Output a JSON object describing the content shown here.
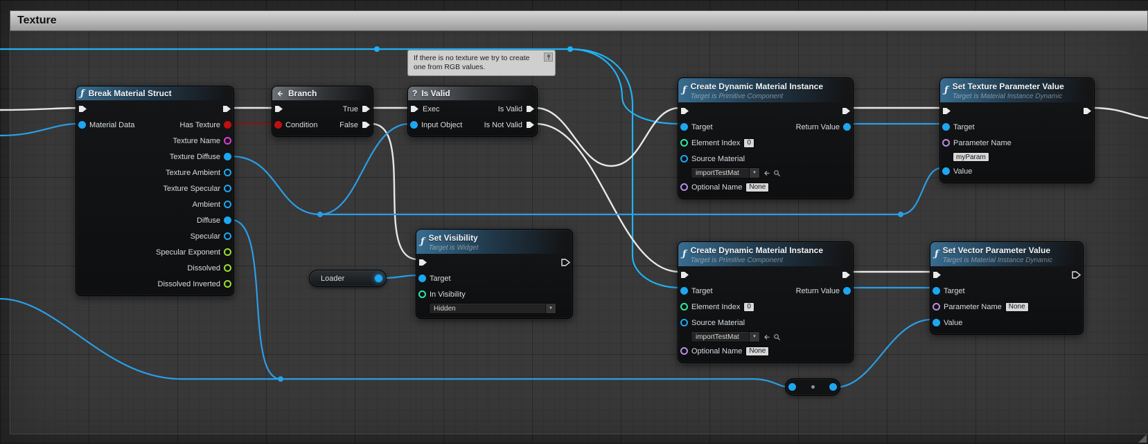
{
  "comment": {
    "title": "Texture"
  },
  "note": {
    "line1": "If there is no texture we try to create",
    "line2": "one from RGB values."
  },
  "nodes": {
    "break_material": {
      "title": "Break Material Struct",
      "input_label": "Material Data",
      "outputs": [
        {
          "label": "Has Texture",
          "type": "bool"
        },
        {
          "label": "Texture Name",
          "type": "string"
        },
        {
          "label": "Texture Diffuse",
          "type": "object"
        },
        {
          "label": "Texture Ambient",
          "type": "object"
        },
        {
          "label": "Texture Specular",
          "type": "object"
        },
        {
          "label": "Ambient",
          "type": "object"
        },
        {
          "label": "Diffuse",
          "type": "object"
        },
        {
          "label": "Specular",
          "type": "object"
        },
        {
          "label": "Specular Exponent",
          "type": "float"
        },
        {
          "label": "Dissolved",
          "type": "float"
        },
        {
          "label": "Dissolved Inverted",
          "type": "float"
        }
      ]
    },
    "branch": {
      "title": "Branch",
      "condition_label": "Condition",
      "true_label": "True",
      "false_label": "False"
    },
    "is_valid": {
      "title": "Is Valid",
      "icon": "?",
      "exec_label": "Exec",
      "input_object_label": "Input Object",
      "is_valid_label": "Is Valid",
      "is_not_valid_label": "Is Not Valid"
    },
    "set_visibility": {
      "title": "Set Visibility",
      "subtitle": "Target is Widget",
      "target_label": "Target",
      "in_visibility_label": "In Visibility",
      "in_visibility_value": "Hidden"
    },
    "loader": {
      "label": "Loader"
    },
    "cdmi_top": {
      "title": "Create Dynamic Material Instance",
      "subtitle": "Target is Primitive Component",
      "target_label": "Target",
      "return_value_label": "Return Value",
      "element_index_label": "Element Index",
      "element_index_value": "0",
      "source_material_label": "Source Material",
      "source_material_value": "importTestMat",
      "optional_name_label": "Optional Name",
      "optional_name_value": "None"
    },
    "cdmi_bottom": {
      "title": "Create Dynamic Material Instance",
      "subtitle": "Target is Primitive Component",
      "target_label": "Target",
      "return_value_label": "Return Value",
      "element_index_label": "Element Index",
      "element_index_value": "0",
      "source_material_label": "Source Material",
      "source_material_value": "importTestMat",
      "optional_name_label": "Optional Name",
      "optional_name_value": "None"
    },
    "set_texture_param": {
      "title": "Set Texture Parameter Value",
      "subtitle": "Target is Material Instance Dynamic",
      "target_label": "Target",
      "parameter_name_label": "Parameter Name",
      "parameter_name_value": "myParam",
      "value_label": "Value"
    },
    "set_vector_param": {
      "title": "Set Vector Parameter Value",
      "subtitle": "Target is Material Instance Dynamic",
      "target_label": "Target",
      "parameter_name_label": "Parameter Name",
      "parameter_name_value": "None",
      "value_label": "Value"
    }
  },
  "colors": {
    "exec_wire": "#e8e8e8",
    "object_wire": "#2a9ee8",
    "cyan_wire": "#1fb3f5",
    "bool_wire": "#8d1414",
    "header_function": "#3a7196",
    "header_flow": "#7a8086",
    "comment_bar": "#c0c0c0",
    "pin_bool": "#c11010",
    "pin_string": "#e23cd8",
    "pin_object": "#1da7f0",
    "pin_float": "#9ae02f",
    "pin_int": "#2fe8a0",
    "pin_name": "#b88fe0"
  }
}
